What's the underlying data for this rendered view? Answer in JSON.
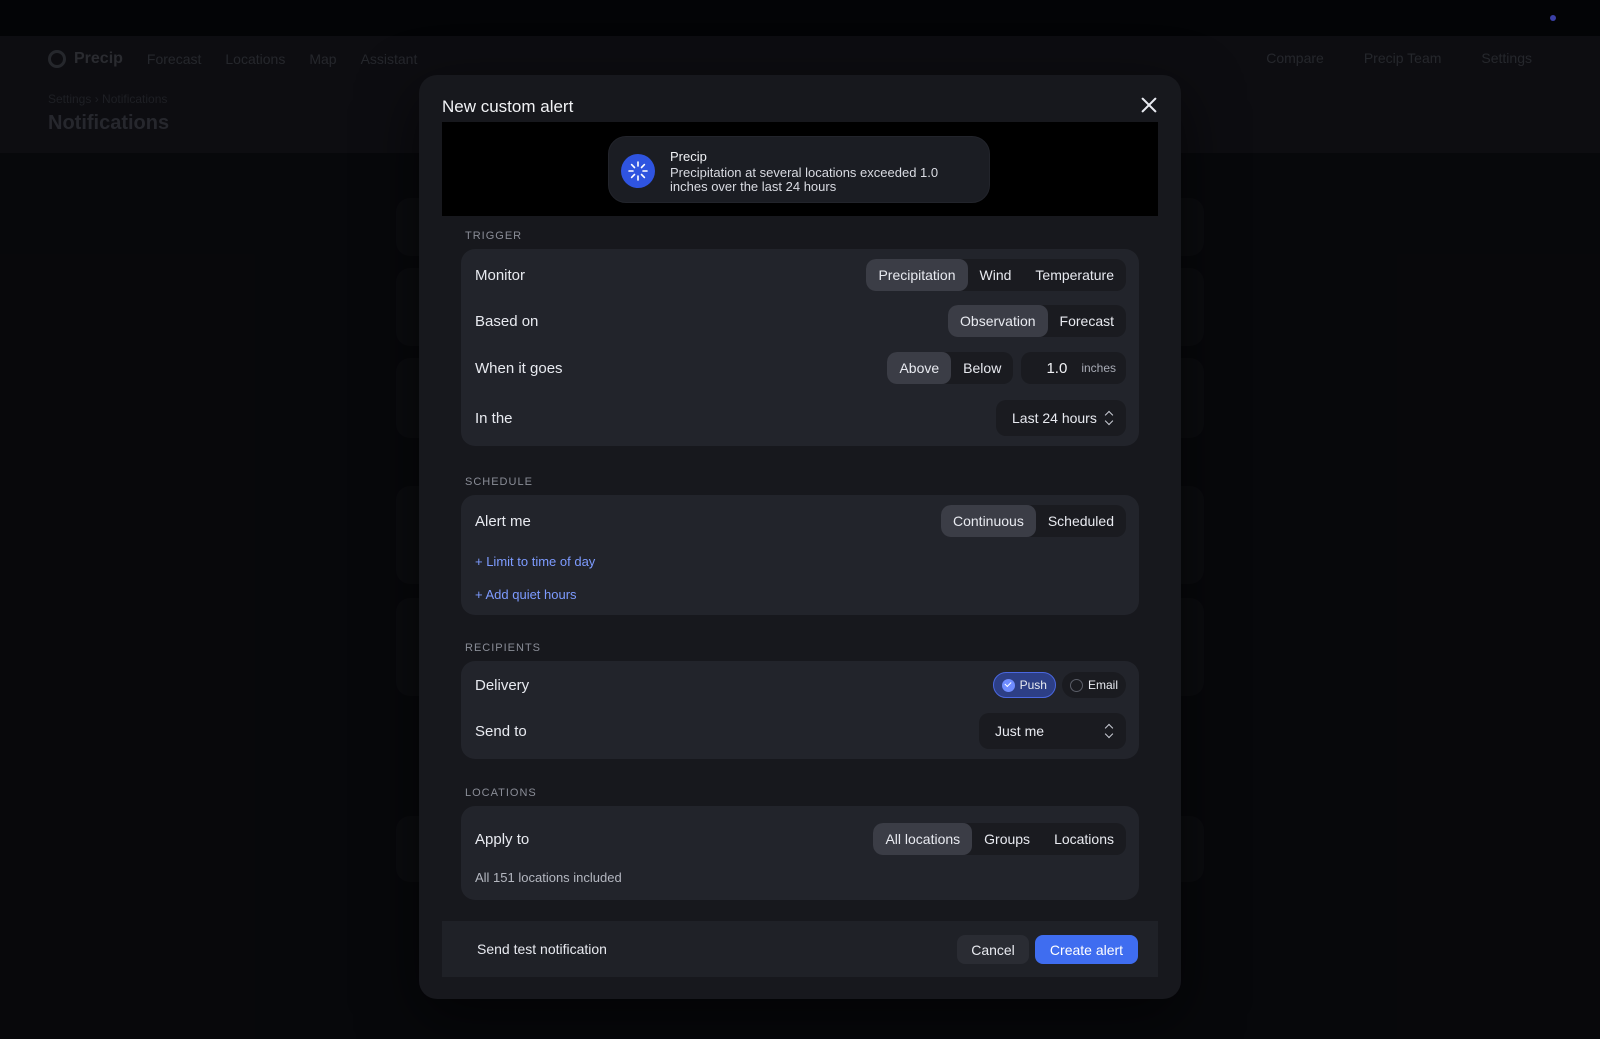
{
  "background_app": {
    "brand": "Precip",
    "nav": [
      "Forecast",
      "Locations",
      "Map",
      "Assistant"
    ],
    "nav_right": [
      "Compare",
      "Precip Team",
      "Settings"
    ],
    "breadcrumb": "Settings › Notifications",
    "page_title": "Notifications"
  },
  "modal": {
    "title": "New custom alert",
    "preview": {
      "app_name": "Precip",
      "message": "Precipitation at several locations exceeded 1.0 inches over the last 24 hours"
    },
    "trigger": {
      "section_label": "TRIGGER",
      "monitor": {
        "label": "Monitor",
        "options": [
          "Precipitation",
          "Wind",
          "Temperature"
        ],
        "selected": "Precipitation"
      },
      "based_on": {
        "label": "Based on",
        "options": [
          "Observation",
          "Forecast"
        ],
        "selected": "Observation"
      },
      "when": {
        "label": "When it goes",
        "options": [
          "Above",
          "Below"
        ],
        "selected": "Above",
        "value": "1.0",
        "unit": "inches"
      },
      "in_the": {
        "label": "In the",
        "value": "Last 24 hours"
      }
    },
    "schedule": {
      "section_label": "SCHEDULE",
      "alert_me": {
        "label": "Alert me",
        "options": [
          "Continuous",
          "Scheduled"
        ],
        "selected": "Continuous"
      },
      "limit_link": "+ Limit to time of day",
      "quiet_link": "+ Add quiet hours"
    },
    "recipients": {
      "section_label": "RECIPIENTS",
      "delivery": {
        "label": "Delivery",
        "push": "Push",
        "email": "Email",
        "push_checked": true,
        "email_checked": false
      },
      "send_to": {
        "label": "Send to",
        "value": "Just me"
      }
    },
    "locations": {
      "section_label": "LOCATIONS",
      "apply_to": {
        "label": "Apply to",
        "options": [
          "All locations",
          "Groups",
          "Locations"
        ],
        "selected": "All locations"
      },
      "summary": "All 151 locations included"
    },
    "footer": {
      "test": "Send test notification",
      "cancel": "Cancel",
      "create": "Create alert"
    }
  },
  "colors": {
    "accent": "#3f6df0",
    "link": "#7d9bff",
    "modal_bg": "#17181d",
    "group_bg": "#22242b"
  }
}
